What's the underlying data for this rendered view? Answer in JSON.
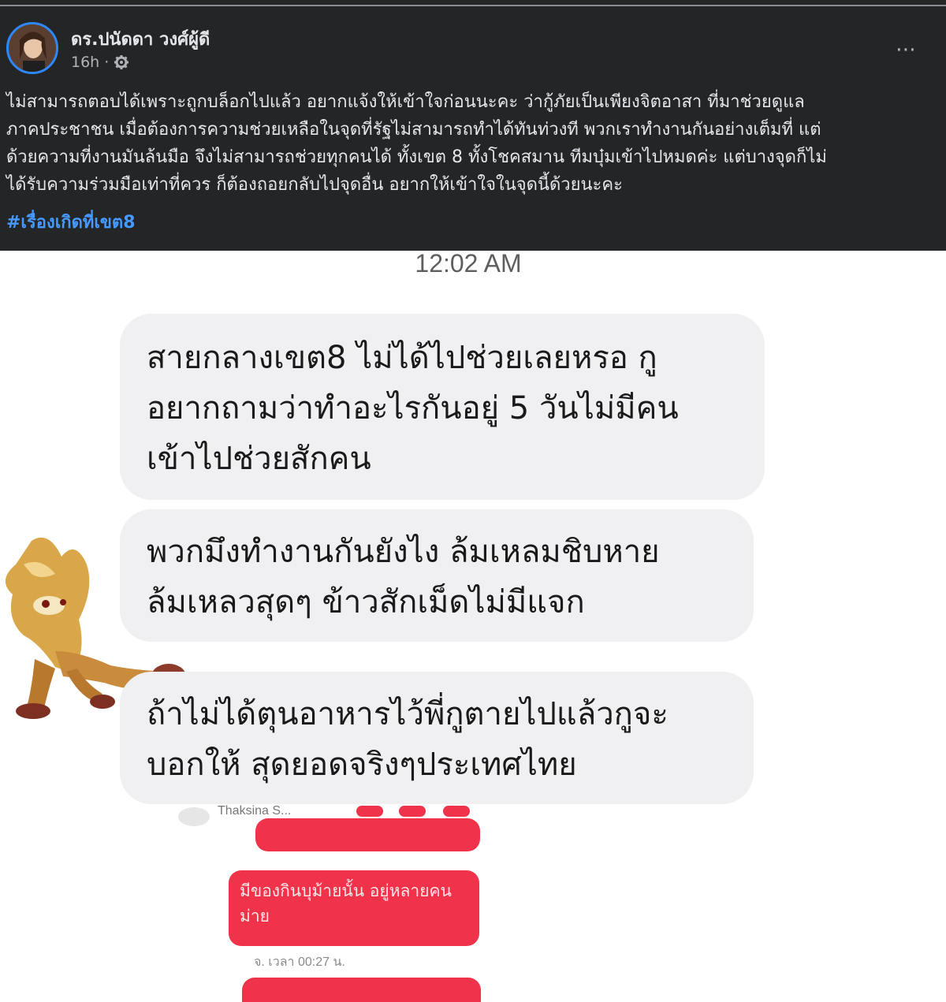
{
  "post": {
    "author": "ดร.ปนัดดา วงศ์ผู้ดี",
    "time": "16h ·",
    "more_icon": "⋯",
    "text": "ไม่สามารถตอบได้เพราะถูกบล็อกไปแล้ว อยากแจ้งให้เข้าใจก่อนนะคะ ว่ากู้ภัยเป็นเพียงจิตอาสา ที่มาช่วยดูแล\nภาคประชาชน เมื่อต้องการความช่วยเหลือในจุดที่รัฐไม่สามารถทำได้ทันท่วงที พวกเราทำงานกันอย่างเต็มที่ แต่\nด้วยความที่งานมันล้นมือ จึงไม่สามารถช่วยทุกคนได้ ทั้งเขต 8 ทั้งโชคสมาน ทีมบุ๋มเข้าไปหมดค่ะ แต่บางจุดก็ไม่\nได้รับความร่วมมือเท่าที่ควร ก็ต้องถอยกลับไปจุดอื่น อยากให้เข้าใจในจุดนี้ด้วยนะคะ",
    "hashtag": "#เรื่องเกิดที่เขต8"
  },
  "chat": {
    "time": "12:02 AM",
    "messages": [
      "สายกลางเขต8 ไม่ได้ไปช่วยเลยหรอ กู\nอยากถามว่าทำอะไรกันอยู่ 5 วันไม่มีคน\nเข้าไปช่วยสักคน",
      "พวกมึงทำงานกันยังไง ล้มเหลมชิบหาย\nล้มเหลวสุดๆ ข้าวสักเม็ดไม่มีแจก",
      "ถ้าไม่ได้ตุนอาหารไว้พี่กูตายไปแล้วกูจะ\nบอกให้ สุดยอดจริงๆประเทศไทย"
    ]
  },
  "embedded": {
    "contact": "Thaksina S...",
    "message": "มีของกินบุม้ายนั้น อยู่หลายคน\nม่าย",
    "timestamp": "จ. เวลา 00:27 น."
  },
  "colors": {
    "post_bg": "#242526",
    "hashtag": "#4599ff",
    "bubble_gray": "#f0f0f3",
    "bubble_red": "#f0324a"
  }
}
